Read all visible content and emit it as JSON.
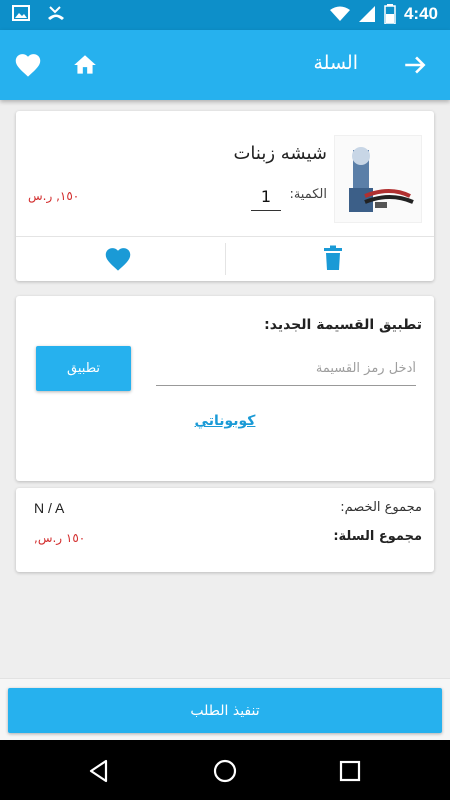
{
  "status_bar": {
    "time": "4:40"
  },
  "app_bar": {
    "title": "السلة"
  },
  "cart_item": {
    "name": "شيشه زبنات",
    "qty_label": "الكمية:",
    "qty_value": "1",
    "price": "١٥٠, ر.س"
  },
  "coupon": {
    "title": "تطبيق القسيمة الجديد:",
    "placeholder": "أدخل رمز القسيمة",
    "apply_label": "تطبيق",
    "coupons_link": "كوبوناتي"
  },
  "summary": {
    "discount_label": "مجموع الخصم:",
    "discount_value": "N / A",
    "total_label": "مجموع السلة:",
    "total_value": "١٥٠ ر.س,"
  },
  "checkout": {
    "label": "تنفيذ الطلب"
  },
  "colors": {
    "primary": "#26b1ee",
    "status_bar": "#0d8fc9",
    "price": "#d32f2f",
    "link": "#1a9ad6"
  },
  "icons": [
    "image-icon",
    "missed-call-icon",
    "wifi-icon",
    "signal-icon",
    "battery-icon",
    "heart-icon",
    "home-icon",
    "arrow-right-icon",
    "trash-icon",
    "back-icon",
    "home-circle-icon",
    "recents-icon"
  ]
}
